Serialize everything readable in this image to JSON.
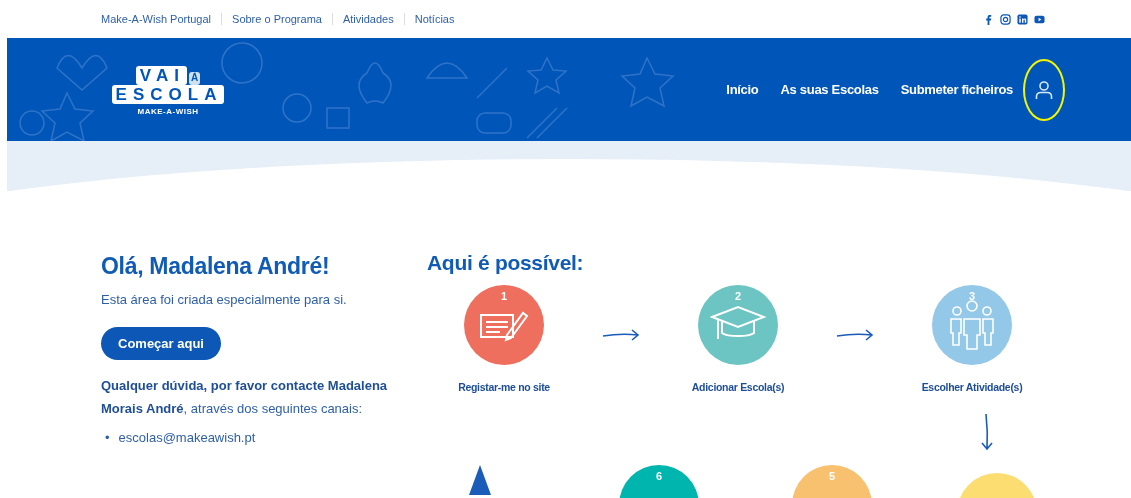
{
  "top_links": [
    {
      "label": "Make-A-Wish Portugal"
    },
    {
      "label": "Sobre o Programa"
    },
    {
      "label": "Atividades"
    },
    {
      "label": "Notícias"
    }
  ],
  "social": [
    {
      "kind": "facebook"
    },
    {
      "kind": "instagram"
    },
    {
      "kind": "linkedin"
    },
    {
      "kind": "youtube"
    }
  ],
  "logo": {
    "top": "VAI",
    "accent": "À",
    "bottom": "ESCOLA",
    "tagline": "MAKE-A-WISH"
  },
  "nav": [
    {
      "label": "Início"
    },
    {
      "label": "As suas Escolas"
    },
    {
      "label": "Submeter ficheiros"
    }
  ],
  "account": {
    "highlighted": true
  },
  "greeting": {
    "title": "Olá, Madalena André!",
    "subtitle": "Esta área foi criada especialmente para si.",
    "button": "Começar aqui",
    "contact": "**Qualquer dúvida, por favor contacte Madalena Morais André**, através dos seguintes canais:",
    "channels": [
      {
        "marker": "•",
        "text": "escolas@makeawish.pt"
      }
    ]
  },
  "steps_title": "Aqui é possível:",
  "steps": [
    {
      "number": "1",
      "label": "Registar-me no site",
      "color": "#ee6f5e"
    },
    {
      "number": "2",
      "label": "Adicionar Escola(s)",
      "color": "#6cc5c2"
    },
    {
      "number": "3",
      "label": "Escolher Atividade(s)",
      "color": "#94c8e8"
    }
  ],
  "next_steps": [
    {
      "kind": "triangle",
      "color": "#1a5cb8"
    },
    {
      "kind": "circle",
      "number": "6",
      "color": "#00b5ad"
    },
    {
      "kind": "circle",
      "number": "5",
      "color": "#f8c16f"
    },
    {
      "kind": "circle",
      "color": "#fbdd72"
    }
  ]
}
